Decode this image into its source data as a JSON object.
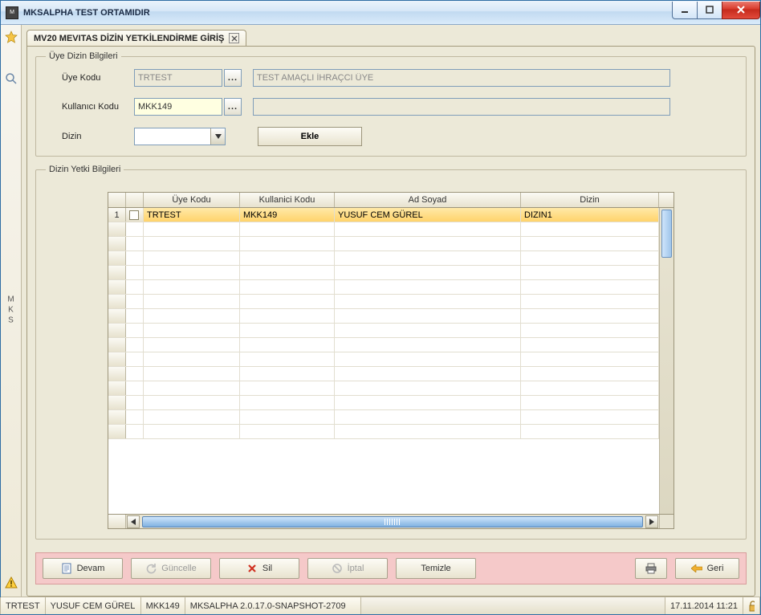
{
  "window": {
    "title": "MKSALPHA TEST ORTAMIDIR"
  },
  "left_rail": {
    "vertical_label": "MKS"
  },
  "tab": {
    "title": "MV20 MEVITAS DİZİN YETKİLENDİRME GİRİŞ"
  },
  "form": {
    "legend": "Üye Dizin Bilgileri",
    "uye_kodu_label": "Üye Kodu",
    "uye_kodu_value": "TRTEST",
    "uye_kodu_desc": "TEST AMAÇLI İHRAÇCI ÜYE",
    "kullanici_kodu_label": "Kullanıcı Kodu",
    "kullanici_kodu_value": "MKK149",
    "kullanici_kodu_desc": "",
    "dizin_label": "Dizin",
    "dizin_value": "",
    "ekle_label": "Ekle",
    "lookup_glyph": "..."
  },
  "grid": {
    "legend": "Dizin Yetki Bilgileri",
    "headers": {
      "uye": "Üye Kodu",
      "kul": "Kullanici Kodu",
      "ad": "Ad Soyad",
      "diz": "Dizin"
    },
    "rows": [
      {
        "num": "1",
        "uye": "TRTEST",
        "kul": "MKK149",
        "ad": "YUSUF CEM GÜREL",
        "diz": "DIZIN1"
      }
    ]
  },
  "actions": {
    "devam": "Devam",
    "guncelle": "Güncelle",
    "sil": "Sil",
    "iptal": "İptal",
    "temizle": "Temizle",
    "geri": "Geri"
  },
  "statusbar": {
    "c1": "TRTEST",
    "c2": "YUSUF CEM GÜREL",
    "c3": "MKK149",
    "c4": "MKSALPHA 2.0.17.0-SNAPSHOT-2709",
    "datetime": "17.11.2014 11:21"
  }
}
